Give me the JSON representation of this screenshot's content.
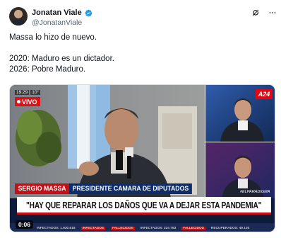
{
  "author": {
    "display_name": "Jonatan Viale",
    "handle": "@JonatanViale",
    "verified": true,
    "verified_color": "#1d9bf0"
  },
  "tweet": {
    "lines": [
      "Massa lo hizo de nuevo.",
      "",
      "2020: Maduro es un dictador.",
      "2026: Pobre Maduro."
    ]
  },
  "top_icons": [
    "grok-icon",
    "more-options-icon"
  ],
  "video": {
    "clock_time": "19:29",
    "clock_temp": "10°",
    "live_label": "VIVO",
    "channel_logo": "A24",
    "lower_third_name": "SERGIO MASSA",
    "lower_third_role": "PRESIDENTE CAMARA DE DIPUTADOS",
    "hashtag": "#ELPARADIGMA",
    "headline": "\"HAY QUE REPARAR LOS DAÑOS QUE VA A DEJAR ESTA PANDEMIA\"",
    "ticker": [
      "INFECTADOS: 1.630.616",
      "INFECTADOS",
      "FALLECIDOS",
      "INFECTADOS: 224.783",
      "FALLECIDOS",
      "RECUPERADOS: 49.120"
    ],
    "duration": "0:06"
  },
  "colors": {
    "live_red": "#d81418",
    "channel_red": "#e30613",
    "lower_navy": "#0d2d6b",
    "handle_gray": "#536471"
  }
}
